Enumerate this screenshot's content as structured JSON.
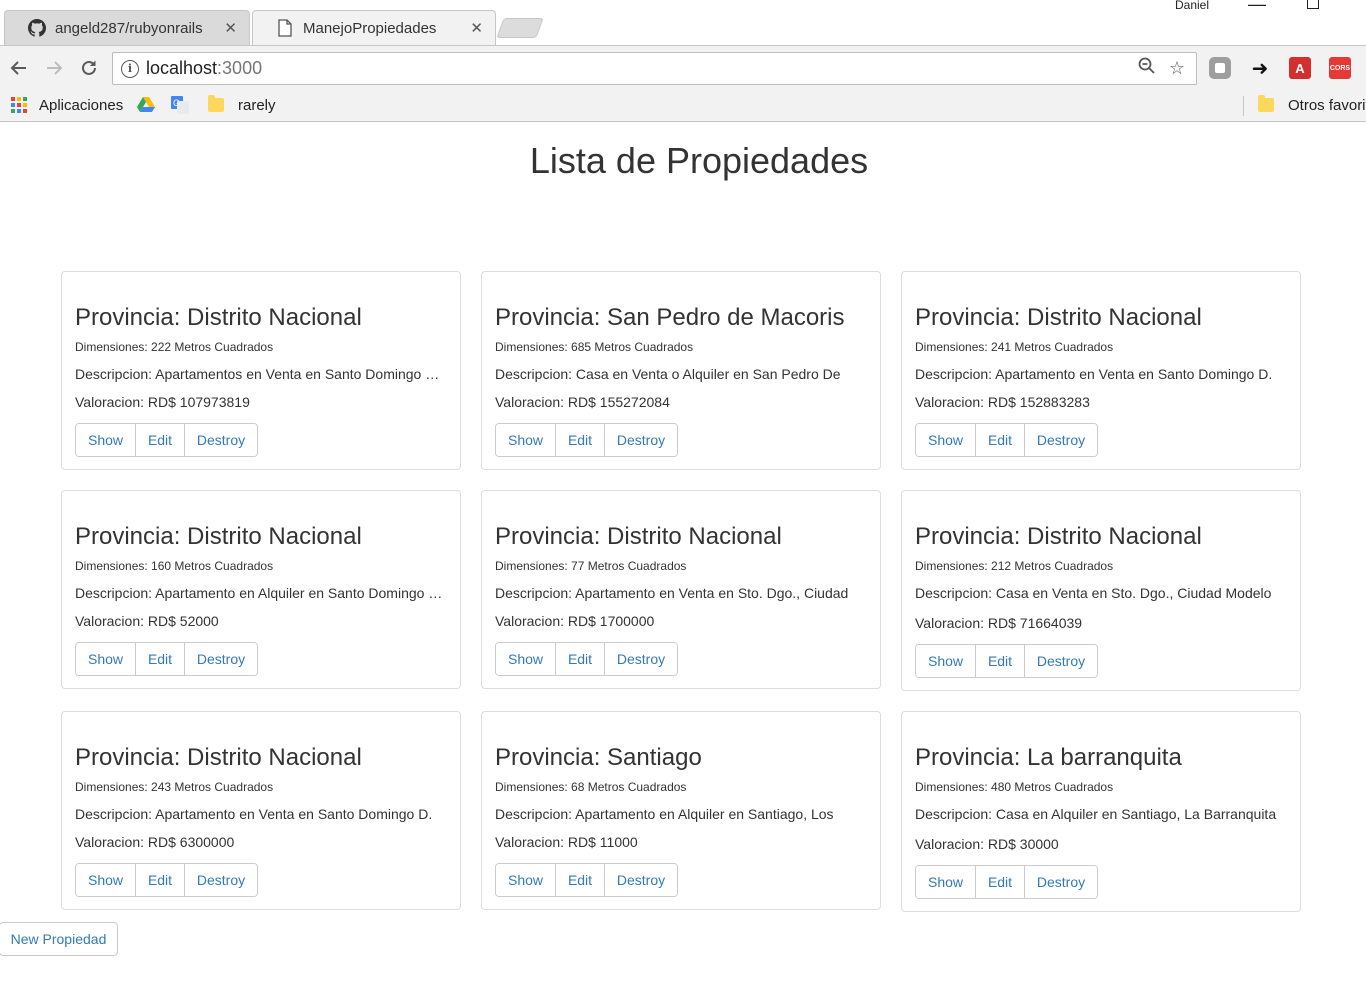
{
  "browser": {
    "tabs": [
      {
        "title": "angeld287/rubyonrails",
        "icon": "github-icon",
        "active": false
      },
      {
        "title": "ManejoPropiedades",
        "icon": "page-icon",
        "active": true
      }
    ],
    "profile_name": "Daniel",
    "url_host": "localhost",
    "url_port": ":3000",
    "bookmarks": {
      "apps_label": "Aplicaciones",
      "folder_label": "rarely",
      "other_label": "Otros favorit"
    },
    "extensions": [
      {
        "name": "shield-extension-icon",
        "color": "#9e9e9e"
      },
      {
        "name": "share-arrow-icon",
        "color": "#222222"
      },
      {
        "name": "pdf-extension-icon",
        "color": "#d32f2f"
      },
      {
        "name": "cors-extension-icon",
        "color": "#e53935",
        "label": "CORS"
      }
    ]
  },
  "page": {
    "title": "Lista de Propiedades",
    "new_button": "New Propiedad",
    "actions": {
      "show": "Show",
      "edit": "Edit",
      "destroy": "Destroy"
    },
    "properties": [
      {
        "provincia": "Provincia: Distrito Nacional",
        "dimensiones": "Dimensiones: 222 Metros Cuadrados",
        "descripcion": "Descripcion: Apartamentos en Venta en Santo Domingo Este",
        "valoracion": "Valoracion: RD$ 107973819"
      },
      {
        "provincia": "Provincia: San Pedro de Macoris",
        "dimensiones": "Dimensiones: 685 Metros Cuadrados",
        "descripcion": "Descripcion: Casa en Venta o Alquiler en San Pedro De",
        "valoracion": "Valoracion: RD$ 155272084"
      },
      {
        "provincia": "Provincia: Distrito Nacional",
        "dimensiones": "Dimensiones: 241 Metros Cuadrados",
        "descripcion": "Descripcion: Apartamento en Venta en Santo Domingo D.",
        "valoracion": "Valoracion: RD$ 152883283"
      },
      {
        "provincia": "Provincia: Distrito Nacional",
        "dimensiones": "Dimensiones: 160 Metros Cuadrados",
        "descripcion": "Descripcion: Apartamento en Alquiler en Santo Domingo Este",
        "valoracion": "Valoracion: RD$ 52000"
      },
      {
        "provincia": "Provincia: Distrito Nacional",
        "dimensiones": "Dimensiones: 77 Metros Cuadrados",
        "descripcion": "Descripcion: Apartamento en Venta en Sto. Dgo., Ciudad",
        "valoracion": "Valoracion: RD$ 1700000"
      },
      {
        "provincia": "Provincia: Distrito Nacional",
        "dimensiones": "Dimensiones: 212 Metros Cuadrados",
        "descripcion": "Descripcion: Casa en Venta en Sto. Dgo., Ciudad Modelo",
        "valoracion": "Valoracion: RD$ 71664039"
      },
      {
        "provincia": "Provincia: Distrito Nacional",
        "dimensiones": "Dimensiones: 243 Metros Cuadrados",
        "descripcion": "Descripcion: Apartamento en Venta en Santo Domingo D.",
        "valoracion": "Valoracion: RD$ 6300000"
      },
      {
        "provincia": "Provincia: Santiago",
        "dimensiones": "Dimensiones: 68 Metros Cuadrados",
        "descripcion": "Descripcion: Apartamento en Alquiler en Santiago, Los",
        "valoracion": "Valoracion: RD$ 11000"
      },
      {
        "provincia": "Provincia: La barranquita",
        "dimensiones": "Dimensiones: 480 Metros Cuadrados",
        "descripcion": "Descripcion: Casa en Alquiler en Santiago, La Barranquita",
        "valoracion": "Valoracion: RD$ 30000"
      }
    ]
  }
}
